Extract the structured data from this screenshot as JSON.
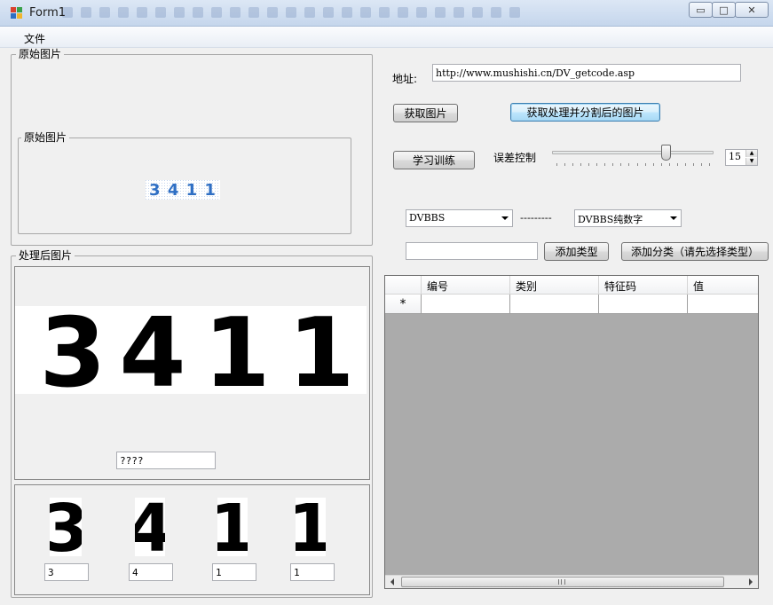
{
  "window": {
    "title": "Form1"
  },
  "menu": {
    "file_label": "文件"
  },
  "original_group": {
    "outer_label": "原始图片",
    "inner_label": "原始图片",
    "captcha_text": "3 4 1 1"
  },
  "processed_group": {
    "label": "处理后图片",
    "recognized_value": "????",
    "big_digits": [
      "3",
      "4",
      "1",
      "1"
    ]
  },
  "segments": [
    {
      "digit": "3",
      "value": "3"
    },
    {
      "digit": "4",
      "value": "4"
    },
    {
      "digit": "1",
      "value": "1"
    },
    {
      "digit": "1",
      "value": "1"
    }
  ],
  "address": {
    "label": "地址:",
    "value": "http://www.mushishi.cn/DV_getcode.asp"
  },
  "buttons": {
    "get_image": "获取图片",
    "get_processed": "获取处理并分割后的图片",
    "train": "学习训练",
    "add_type": "添加类型",
    "add_category": "添加分类（请先选择类型）"
  },
  "error_control": {
    "label": "误差控制",
    "slider_level": 0.73,
    "value": "15"
  },
  "dropdowns": {
    "left_selected": "DVBBS",
    "separator": "---------",
    "right_selected": "DVBBS纯数字"
  },
  "type_input": {
    "value": ""
  },
  "grid": {
    "columns": [
      "编号",
      "类别",
      "特征码",
      "值"
    ],
    "new_row_marker": "*"
  },
  "colors": {
    "captcha_blue": "#2f6fc4",
    "grid_background": "#ababab",
    "focused_button": "#3c7fb1"
  }
}
